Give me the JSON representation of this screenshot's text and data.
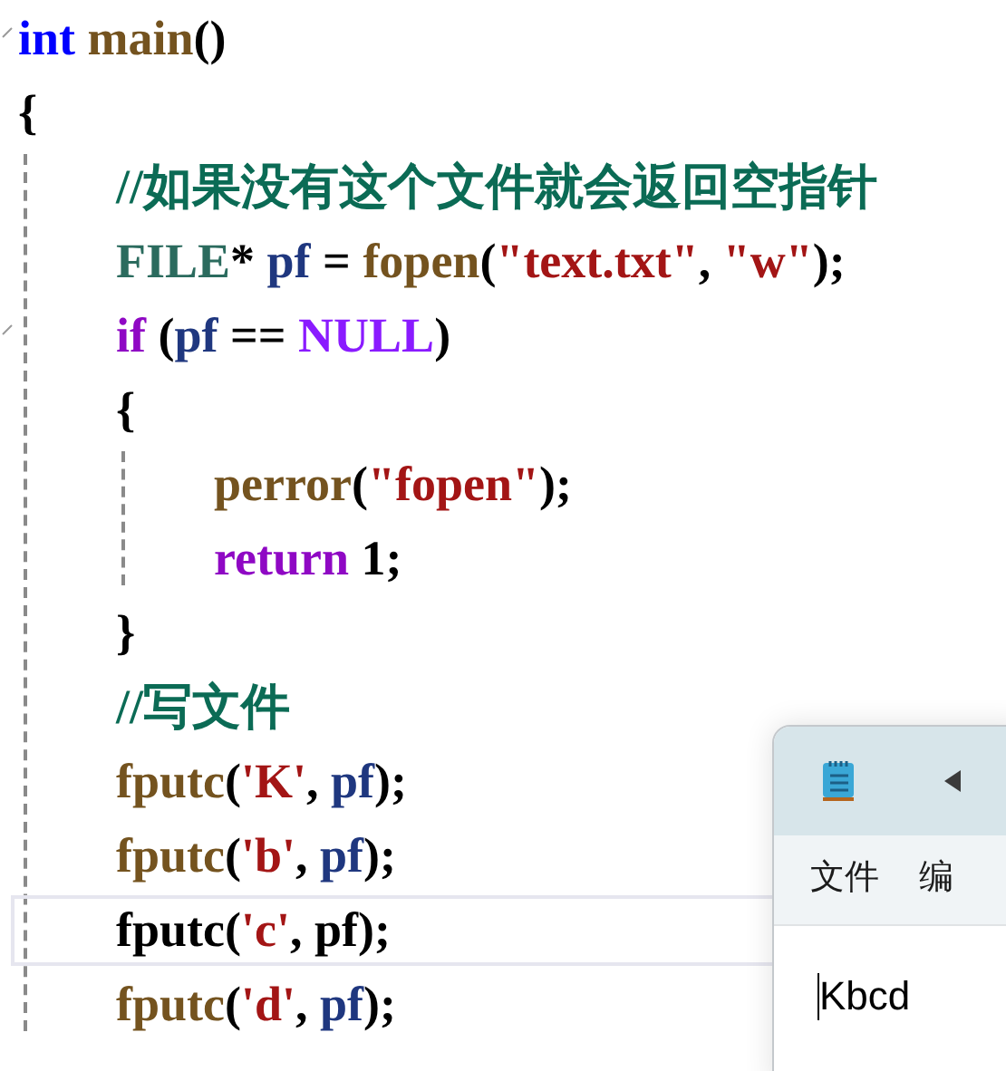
{
  "code": [
    {
      "tokens": [
        {
          "kind": "keyword",
          "text": "int"
        },
        {
          "kind": "func",
          "text": " main"
        },
        {
          "kind": "plain",
          "text": "()"
        }
      ]
    },
    {
      "tokens": [
        {
          "kind": "plain",
          "text": "{"
        }
      ],
      "children": [
        {
          "tokens": [
            {
              "kind": "comment",
              "text": "//如果没有这个文件就会返回空指针"
            }
          ]
        },
        {
          "tokens": [
            {
              "kind": "type",
              "text": "FILE"
            },
            {
              "kind": "plain",
              "text": "* "
            },
            {
              "kind": "var",
              "text": "pf"
            },
            {
              "kind": "plain",
              "text": " = "
            },
            {
              "kind": "func",
              "text": "fopen"
            },
            {
              "kind": "plain",
              "text": "("
            },
            {
              "kind": "string",
              "text": "\"text.txt\""
            },
            {
              "kind": "plain",
              "text": ", "
            },
            {
              "kind": "string",
              "text": "\"w\""
            },
            {
              "kind": "plain",
              "text": ");"
            }
          ]
        },
        {
          "tokens": [
            {
              "kind": "control",
              "text": "if"
            },
            {
              "kind": "plain",
              "text": " ("
            },
            {
              "kind": "var",
              "text": "pf"
            },
            {
              "kind": "plain",
              "text": " == "
            },
            {
              "kind": "macro",
              "text": "NULL"
            },
            {
              "kind": "plain",
              "text": ")"
            }
          ]
        },
        {
          "tokens": [
            {
              "kind": "plain",
              "text": "{"
            }
          ],
          "children": [
            {
              "tokens": [
                {
                  "kind": "func",
                  "text": "perror"
                },
                {
                  "kind": "plain",
                  "text": "("
                },
                {
                  "kind": "string",
                  "text": "\"fopen\""
                },
                {
                  "kind": "plain",
                  "text": ");"
                }
              ]
            },
            {
              "tokens": [
                {
                  "kind": "control",
                  "text": "return"
                },
                {
                  "kind": "plain",
                  "text": " 1;"
                }
              ]
            }
          ]
        },
        {
          "tokens": [
            {
              "kind": "plain",
              "text": "}"
            }
          ]
        },
        {
          "tokens": [
            {
              "kind": "comment",
              "text": "//写文件"
            }
          ]
        },
        {
          "tokens": [
            {
              "kind": "func",
              "text": "fputc"
            },
            {
              "kind": "plain",
              "text": "("
            },
            {
              "kind": "string",
              "text": "'K'"
            },
            {
              "kind": "plain",
              "text": ", "
            },
            {
              "kind": "var",
              "text": "pf"
            },
            {
              "kind": "plain",
              "text": ");"
            }
          ]
        },
        {
          "tokens": [
            {
              "kind": "func",
              "text": "fputc"
            },
            {
              "kind": "plain",
              "text": "("
            },
            {
              "kind": "string",
              "text": "'b'"
            },
            {
              "kind": "plain",
              "text": ", "
            },
            {
              "kind": "var",
              "text": "pf"
            },
            {
              "kind": "plain",
              "text": ");"
            }
          ]
        },
        {
          "current": true,
          "tokens": [
            {
              "kind": "plain",
              "text": "fputc("
            },
            {
              "kind": "string",
              "text": "'c'"
            },
            {
              "kind": "plain",
              "text": ", pf);"
            }
          ]
        },
        {
          "tokens": [
            {
              "kind": "func",
              "text": "fputc"
            },
            {
              "kind": "plain",
              "text": "("
            },
            {
              "kind": "string",
              "text": "'d'"
            },
            {
              "kind": "plain",
              "text": ", "
            },
            {
              "kind": "var",
              "text": "pf"
            },
            {
              "kind": "plain",
              "text": ");"
            }
          ]
        }
      ]
    }
  ],
  "notepad": {
    "menu": [
      "文件",
      "编"
    ],
    "text": "Kbcd"
  }
}
